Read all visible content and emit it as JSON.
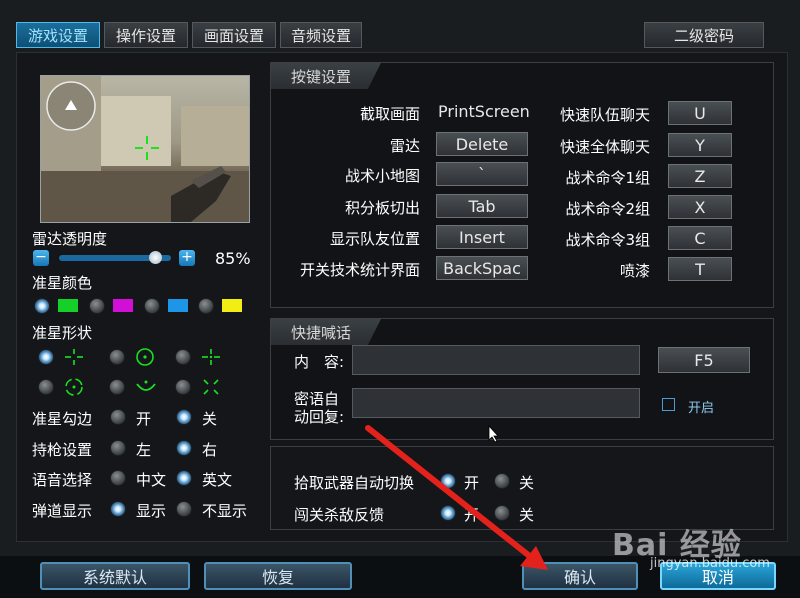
{
  "tabs": [
    "游戏设置",
    "操作设置",
    "画面设置",
    "音频设置"
  ],
  "secondary_password": "二级密码",
  "radar": {
    "opacity_label": "雷达透明度",
    "value": 85,
    "value_text": "85%"
  },
  "crosshair_color": {
    "label": "准星颜色",
    "options": [
      "#16d02a",
      "#d20fd6",
      "#1d96e8",
      "#f2ee14"
    ]
  },
  "crosshair_shape": {
    "label": "准星形状",
    "shapes": [
      "-|-",
      "(·)",
      "-|-",
      "(·)",
      "‿",
      "✕"
    ]
  },
  "options": {
    "outline": {
      "label": "准星勾边",
      "on": "开",
      "off": "关"
    },
    "hand": {
      "label": "持枪设置",
      "left": "左",
      "right": "右"
    },
    "voice": {
      "label": "语音选择",
      "cn": "中文",
      "en": "英文"
    },
    "ballistic": {
      "label": "弹道显示",
      "show": "显示",
      "hide": "不显示"
    },
    "auto_switch": {
      "label": "拾取武器自动切换",
      "on": "开",
      "off": "关"
    },
    "kill_feedback": {
      "label": "闯关杀敌反馈",
      "on": "开",
      "off": "关"
    }
  },
  "keys": {
    "title": "按键设置",
    "left": [
      {
        "label": "截取画面",
        "key": "PrintScreen"
      },
      {
        "label": "雷达",
        "key": "Delete"
      },
      {
        "label": "战术小地图",
        "key": "`"
      },
      {
        "label": "积分板切出",
        "key": "Tab"
      },
      {
        "label": "显示队友位置",
        "key": "Insert"
      },
      {
        "label": "开关技术统计界面",
        "key": "BackSpac"
      }
    ],
    "right": [
      {
        "label": "快速队伍聊天",
        "key": "U"
      },
      {
        "label": "快速全体聊天",
        "key": "Y"
      },
      {
        "label": "战术命令1组",
        "key": "Z"
      },
      {
        "label": "战术命令2组",
        "key": "X"
      },
      {
        "label": "战术命令3组",
        "key": "C"
      },
      {
        "label": "喷漆",
        "key": "T"
      }
    ]
  },
  "chat": {
    "title": "快捷喊话",
    "content_label": "内　容:",
    "content_key": "F5",
    "auto_reply_label_1": "密语自",
    "auto_reply_label_2": "动回复:",
    "enable_label": "开启"
  },
  "bottom": {
    "default": "系统默认",
    "restore": "恢复",
    "confirm": "确认",
    "cancel": "取消"
  },
  "watermark": {
    "text": "Bai 经验",
    "url": "jingyan.baidu.com"
  }
}
